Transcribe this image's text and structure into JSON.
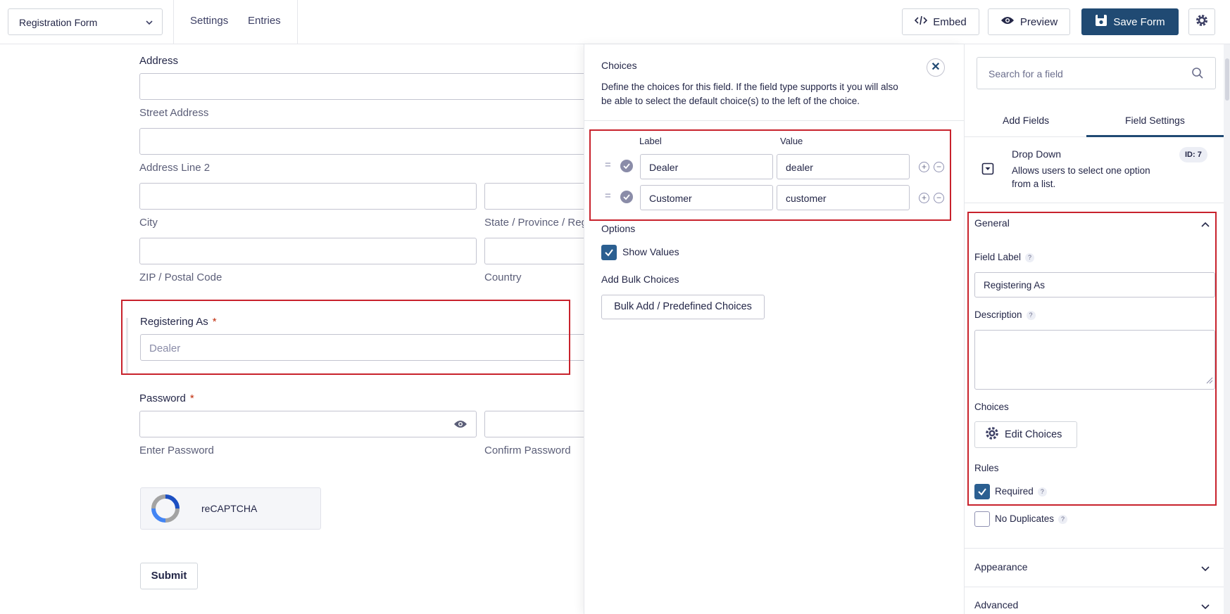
{
  "topbar": {
    "form_name": "Registration Form",
    "nav": [
      "Settings",
      "Entries"
    ],
    "embed_label": "Embed",
    "preview_label": "Preview",
    "save_label": "Save Form"
  },
  "form": {
    "address_label": "Address",
    "street_sub": "Street Address",
    "line2_sub": "Address Line 2",
    "city_sub": "City",
    "state_sub": "State / Province / Region",
    "zip_sub": "ZIP / Postal Code",
    "country_sub": "Country",
    "registering_label": "Registering As",
    "registering_value": "Dealer",
    "password_label": "Password",
    "enter_password_sub": "Enter Password",
    "confirm_password_sub": "Confirm Password",
    "recaptcha_label": "reCAPTCHA",
    "submit_label": "Submit",
    "required_mark": "*"
  },
  "choices_flyout": {
    "title": "Choices",
    "description_line1": "Define the choices for this field. If the field type supports it you will also",
    "description_line2": "be able to select the default choice(s) to the left of the choice.",
    "col_label": "Label",
    "col_value": "Value",
    "rows": [
      {
        "label": "Dealer",
        "value": "dealer"
      },
      {
        "label": "Customer",
        "value": "customer"
      }
    ],
    "options_heading": "Options",
    "show_values_label": "Show Values",
    "show_values_checked": true,
    "bulk_heading": "Add Bulk Choices",
    "bulk_button": "Bulk Add / Predefined Choices"
  },
  "right_panel": {
    "search_placeholder": "Search for a field",
    "tabs": [
      "Add Fields",
      "Field Settings"
    ],
    "active_tab": "Field Settings",
    "field_type": "Drop Down",
    "field_desc_line1": "Allows users to select one option",
    "field_desc_line2": "from a list.",
    "field_id": "ID: 7",
    "general_heading": "General",
    "field_label_label": "Field Label",
    "field_label_value": "Registering As",
    "description_label": "Description",
    "choices_label": "Choices",
    "edit_choices_button": "Edit Choices",
    "rules_label": "Rules",
    "required_label": "Required",
    "required_checked": true,
    "no_duplicates_label": "No Duplicates",
    "no_duplicates_checked": false,
    "help_mark": "?",
    "appearance_heading": "Appearance",
    "advanced_heading": "Advanced"
  },
  "colors": {
    "primary": "#204a73",
    "checkbox": "#2b5f91",
    "highlight": "#c8222c",
    "required": "#c02b0a"
  }
}
